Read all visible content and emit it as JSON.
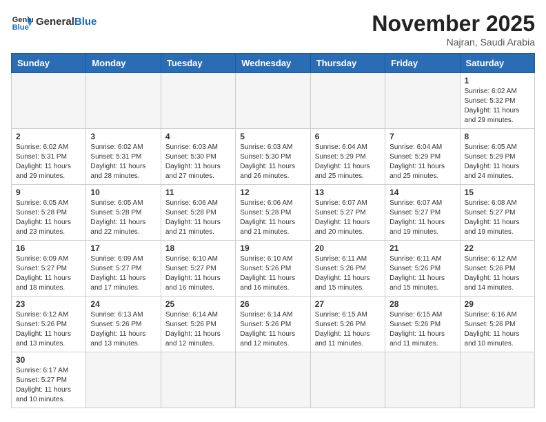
{
  "header": {
    "logo_general": "General",
    "logo_blue": "Blue",
    "month_title": "November 2025",
    "location": "Najran, Saudi Arabia"
  },
  "days_of_week": [
    "Sunday",
    "Monday",
    "Tuesday",
    "Wednesday",
    "Thursday",
    "Friday",
    "Saturday"
  ],
  "weeks": [
    [
      {
        "day": "",
        "info": ""
      },
      {
        "day": "",
        "info": ""
      },
      {
        "day": "",
        "info": ""
      },
      {
        "day": "",
        "info": ""
      },
      {
        "day": "",
        "info": ""
      },
      {
        "day": "",
        "info": ""
      },
      {
        "day": "1",
        "info": "Sunrise: 6:02 AM\nSunset: 5:32 PM\nDaylight: 11 hours and 29 minutes."
      }
    ],
    [
      {
        "day": "2",
        "info": "Sunrise: 6:02 AM\nSunset: 5:31 PM\nDaylight: 11 hours and 29 minutes."
      },
      {
        "day": "3",
        "info": "Sunrise: 6:02 AM\nSunset: 5:31 PM\nDaylight: 11 hours and 28 minutes."
      },
      {
        "day": "4",
        "info": "Sunrise: 6:03 AM\nSunset: 5:30 PM\nDaylight: 11 hours and 27 minutes."
      },
      {
        "day": "5",
        "info": "Sunrise: 6:03 AM\nSunset: 5:30 PM\nDaylight: 11 hours and 26 minutes."
      },
      {
        "day": "6",
        "info": "Sunrise: 6:04 AM\nSunset: 5:29 PM\nDaylight: 11 hours and 25 minutes."
      },
      {
        "day": "7",
        "info": "Sunrise: 6:04 AM\nSunset: 5:29 PM\nDaylight: 11 hours and 25 minutes."
      },
      {
        "day": "8",
        "info": "Sunrise: 6:05 AM\nSunset: 5:29 PM\nDaylight: 11 hours and 24 minutes."
      }
    ],
    [
      {
        "day": "9",
        "info": "Sunrise: 6:05 AM\nSunset: 5:28 PM\nDaylight: 11 hours and 23 minutes."
      },
      {
        "day": "10",
        "info": "Sunrise: 6:05 AM\nSunset: 5:28 PM\nDaylight: 11 hours and 22 minutes."
      },
      {
        "day": "11",
        "info": "Sunrise: 6:06 AM\nSunset: 5:28 PM\nDaylight: 11 hours and 21 minutes."
      },
      {
        "day": "12",
        "info": "Sunrise: 6:06 AM\nSunset: 5:28 PM\nDaylight: 11 hours and 21 minutes."
      },
      {
        "day": "13",
        "info": "Sunrise: 6:07 AM\nSunset: 5:27 PM\nDaylight: 11 hours and 20 minutes."
      },
      {
        "day": "14",
        "info": "Sunrise: 6:07 AM\nSunset: 5:27 PM\nDaylight: 11 hours and 19 minutes."
      },
      {
        "day": "15",
        "info": "Sunrise: 6:08 AM\nSunset: 5:27 PM\nDaylight: 11 hours and 19 minutes."
      }
    ],
    [
      {
        "day": "16",
        "info": "Sunrise: 6:09 AM\nSunset: 5:27 PM\nDaylight: 11 hours and 18 minutes."
      },
      {
        "day": "17",
        "info": "Sunrise: 6:09 AM\nSunset: 5:27 PM\nDaylight: 11 hours and 17 minutes."
      },
      {
        "day": "18",
        "info": "Sunrise: 6:10 AM\nSunset: 5:27 PM\nDaylight: 11 hours and 16 minutes."
      },
      {
        "day": "19",
        "info": "Sunrise: 6:10 AM\nSunset: 5:26 PM\nDaylight: 11 hours and 16 minutes."
      },
      {
        "day": "20",
        "info": "Sunrise: 6:11 AM\nSunset: 5:26 PM\nDaylight: 11 hours and 15 minutes."
      },
      {
        "day": "21",
        "info": "Sunrise: 6:11 AM\nSunset: 5:26 PM\nDaylight: 11 hours and 15 minutes."
      },
      {
        "day": "22",
        "info": "Sunrise: 6:12 AM\nSunset: 5:26 PM\nDaylight: 11 hours and 14 minutes."
      }
    ],
    [
      {
        "day": "23",
        "info": "Sunrise: 6:12 AM\nSunset: 5:26 PM\nDaylight: 11 hours and 13 minutes."
      },
      {
        "day": "24",
        "info": "Sunrise: 6:13 AM\nSunset: 5:26 PM\nDaylight: 11 hours and 13 minutes."
      },
      {
        "day": "25",
        "info": "Sunrise: 6:14 AM\nSunset: 5:26 PM\nDaylight: 11 hours and 12 minutes."
      },
      {
        "day": "26",
        "info": "Sunrise: 6:14 AM\nSunset: 5:26 PM\nDaylight: 11 hours and 12 minutes."
      },
      {
        "day": "27",
        "info": "Sunrise: 6:15 AM\nSunset: 5:26 PM\nDaylight: 11 hours and 11 minutes."
      },
      {
        "day": "28",
        "info": "Sunrise: 6:15 AM\nSunset: 5:26 PM\nDaylight: 11 hours and 11 minutes."
      },
      {
        "day": "29",
        "info": "Sunrise: 6:16 AM\nSunset: 5:26 PM\nDaylight: 11 hours and 10 minutes."
      }
    ],
    [
      {
        "day": "30",
        "info": "Sunrise: 6:17 AM\nSunset: 5:27 PM\nDaylight: 11 hours and 10 minutes."
      },
      {
        "day": "",
        "info": ""
      },
      {
        "day": "",
        "info": ""
      },
      {
        "day": "",
        "info": ""
      },
      {
        "day": "",
        "info": ""
      },
      {
        "day": "",
        "info": ""
      },
      {
        "day": "",
        "info": ""
      }
    ]
  ]
}
